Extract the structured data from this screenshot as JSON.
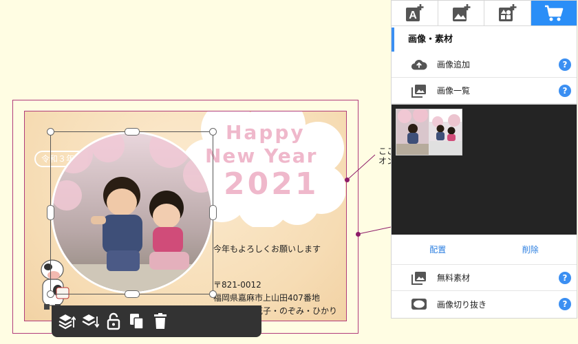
{
  "card": {
    "greeting_line1": "Happy",
    "greeting_line2": "New Year",
    "greeting_year": "2021",
    "era_label": "令和３年",
    "message": "今年もよろしくお願いします",
    "postal": "〒821-0012",
    "address": "福岡県嘉麻市上山田407番地",
    "names": "山田太郎・花子・のぞみ・ひかり"
  },
  "callout": {
    "line1": "ここ",
    "line2": "オン"
  },
  "toolbar": {
    "items": [
      "layer-up-icon",
      "layer-down-icon",
      "unlock-icon",
      "copy-icon",
      "trash-icon"
    ]
  },
  "panel": {
    "tabs": [
      "add-text-icon",
      "add-image-icon",
      "add-shape-icon",
      "cart-icon"
    ],
    "active_tab": 3,
    "section_title": "画像・素材",
    "rows": {
      "add_image": "画像追加",
      "image_list": "画像一覧",
      "free_material": "無料素材",
      "crop_image": "画像切り抜き"
    },
    "help_label": "?",
    "actions": {
      "place": "配置",
      "delete": "削除"
    }
  },
  "colors": {
    "accent": "#2a8ef7",
    "frame": "#b03a7a",
    "card_bg": "#f6dcb4",
    "greeting": "#efb8cb",
    "page_bg": "#fffde3",
    "gallery_bg": "#242424"
  }
}
